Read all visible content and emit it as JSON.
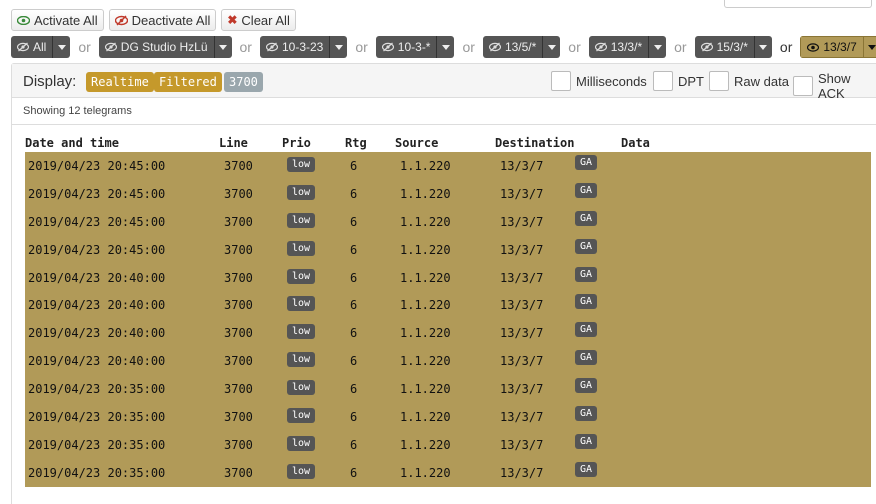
{
  "actions": {
    "activate_all": "Activate All",
    "deactivate_all": "Deactivate All",
    "clear_all": "Clear All"
  },
  "filters": {
    "or_label": "or",
    "items": [
      {
        "label": "All",
        "active": false
      },
      {
        "label": "DG Studio HzLü",
        "active": false
      },
      {
        "label": "10-3-23",
        "active": false
      },
      {
        "label": "10-3-*",
        "active": false
      },
      {
        "label": "13/5/*",
        "active": false
      },
      {
        "label": "13/3/*",
        "active": false
      },
      {
        "label": "15/3/*",
        "active": false
      },
      {
        "label": "13/3/7",
        "active": true
      }
    ]
  },
  "display": {
    "label": "Display:",
    "realtime": "Realtime",
    "filtered": "Filtered",
    "count": "3700",
    "options": {
      "milliseconds": "Milliseconds",
      "dpt": "DPT",
      "raw_data": "Raw data",
      "show_ack": "Show ACK"
    }
  },
  "showing": "Showing 12 telegrams",
  "table": {
    "headers": {
      "datetime": "Date and time",
      "line": "Line",
      "prio": "Prio",
      "rtg": "Rtg",
      "source": "Source",
      "destination": "Destination",
      "data": "Data"
    },
    "rows": [
      {
        "datetime": "2019/04/23 20:45:00",
        "line": "3700",
        "prio": "low",
        "rtg": "6",
        "source": "1.1.220",
        "destination": "13/3/7",
        "type": "GA"
      },
      {
        "datetime": "2019/04/23 20:45:00",
        "line": "3700",
        "prio": "low",
        "rtg": "6",
        "source": "1.1.220",
        "destination": "13/3/7",
        "type": "GA"
      },
      {
        "datetime": "2019/04/23 20:45:00",
        "line": "3700",
        "prio": "low",
        "rtg": "6",
        "source": "1.1.220",
        "destination": "13/3/7",
        "type": "GA"
      },
      {
        "datetime": "2019/04/23 20:45:00",
        "line": "3700",
        "prio": "low",
        "rtg": "6",
        "source": "1.1.220",
        "destination": "13/3/7",
        "type": "GA"
      },
      {
        "datetime": "2019/04/23 20:40:00",
        "line": "3700",
        "prio": "low",
        "rtg": "6",
        "source": "1.1.220",
        "destination": "13/3/7",
        "type": "GA"
      },
      {
        "datetime": "2019/04/23 20:40:00",
        "line": "3700",
        "prio": "low",
        "rtg": "6",
        "source": "1.1.220",
        "destination": "13/3/7",
        "type": "GA"
      },
      {
        "datetime": "2019/04/23 20:40:00",
        "line": "3700",
        "prio": "low",
        "rtg": "6",
        "source": "1.1.220",
        "destination": "13/3/7",
        "type": "GA"
      },
      {
        "datetime": "2019/04/23 20:40:00",
        "line": "3700",
        "prio": "low",
        "rtg": "6",
        "source": "1.1.220",
        "destination": "13/3/7",
        "type": "GA"
      },
      {
        "datetime": "2019/04/23 20:35:00",
        "line": "3700",
        "prio": "low",
        "rtg": "6",
        "source": "1.1.220",
        "destination": "13/3/7",
        "type": "GA"
      },
      {
        "datetime": "2019/04/23 20:35:00",
        "line": "3700",
        "prio": "low",
        "rtg": "6",
        "source": "1.1.220",
        "destination": "13/3/7",
        "type": "GA"
      },
      {
        "datetime": "2019/04/23 20:35:00",
        "line": "3700",
        "prio": "low",
        "rtg": "6",
        "source": "1.1.220",
        "destination": "13/3/7",
        "type": "GA"
      },
      {
        "datetime": "2019/04/23 20:35:00",
        "line": "3700",
        "prio": "low",
        "rtg": "6",
        "source": "1.1.220",
        "destination": "13/3/7",
        "type": "GA"
      }
    ]
  },
  "colors": {
    "row_bg": "#b19a58",
    "badge_gold": "#c5992b",
    "badge_gray": "#9aa7ad",
    "filter_dark": "#555555"
  }
}
